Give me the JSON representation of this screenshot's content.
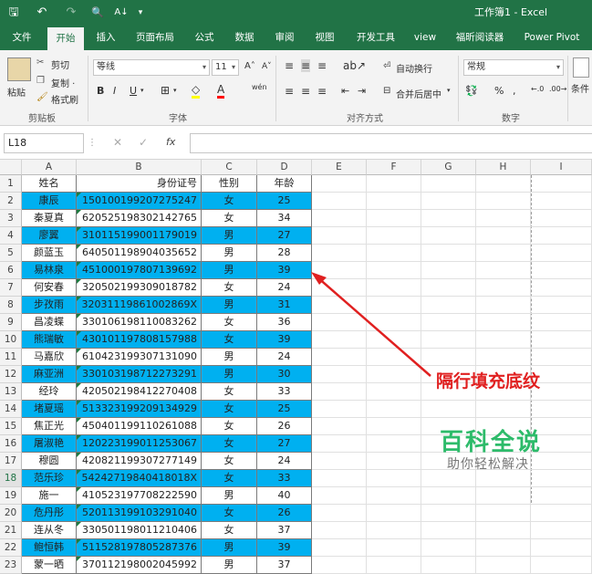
{
  "window": {
    "title": "工作簿1 - Excel",
    "quick_access": {
      "save": "🖫",
      "undo": "↶",
      "redo": "↷",
      "preview": "🔍",
      "sort": "A↓",
      "more": "▾"
    }
  },
  "tabs": [
    "文件",
    "开始",
    "插入",
    "页面布局",
    "公式",
    "数据",
    "审阅",
    "视图",
    "开发工具",
    "view",
    "福昕阅读器",
    "Power Pivot"
  ],
  "active_tab": "开始",
  "ribbon": {
    "clipboard": {
      "paste": "粘贴",
      "cut": "剪切",
      "copy": "复制 ·",
      "format_painter": "格式刷",
      "label": "剪贴板"
    },
    "font": {
      "name": "等线",
      "size": "11",
      "grow": "A˄",
      "shrink": "A˅",
      "bold": "B",
      "italic": "I",
      "underline": "U",
      "wen": "wén",
      "label": "字体"
    },
    "alignment": {
      "wrap": "自动换行",
      "merge": "合并后居中",
      "label": "对齐方式"
    },
    "number": {
      "format": "常规",
      "percent": "%",
      "comma": ",",
      "label": "数字"
    },
    "styles": {
      "cond": "条件"
    }
  },
  "formula_bar": {
    "name_box": "L18",
    "fx": "fx",
    "value": ""
  },
  "colors": {
    "band_fill": "#00B0F0",
    "accent": "#217346",
    "annotation": "#E02020",
    "watermark": "#2DBB6A"
  },
  "columns": [
    "A",
    "B",
    "C",
    "D",
    "E",
    "F",
    "G",
    "H",
    "I"
  ],
  "headers": [
    "姓名",
    "身份证号",
    "性别",
    "年龄"
  ],
  "rows": [
    {
      "n": "1"
    },
    {
      "n": "2",
      "name": "康辰",
      "id": "150100199207275247",
      "sex": "女",
      "age": "25"
    },
    {
      "n": "3",
      "name": "秦夏真",
      "id": "620525198302142765",
      "sex": "女",
      "age": "34"
    },
    {
      "n": "4",
      "name": "廖翼",
      "id": "310115199001179019",
      "sex": "男",
      "age": "27"
    },
    {
      "n": "5",
      "name": "颜蓝玉",
      "id": "640501198904035652",
      "sex": "男",
      "age": "28"
    },
    {
      "n": "6",
      "name": "易林泉",
      "id": "451000197807139692",
      "sex": "男",
      "age": "39"
    },
    {
      "n": "7",
      "name": "何安春",
      "id": "320502199309018782",
      "sex": "女",
      "age": "24"
    },
    {
      "n": "8",
      "name": "步孜雨",
      "id": "32031119861002869X",
      "sex": "男",
      "age": "31"
    },
    {
      "n": "9",
      "name": "昌凌蝶",
      "id": "330106198110083262",
      "sex": "女",
      "age": "36"
    },
    {
      "n": "10",
      "name": "熊瑞敏",
      "id": "430101197808157988",
      "sex": "女",
      "age": "39"
    },
    {
      "n": "11",
      "name": "马嘉欣",
      "id": "610423199307131090",
      "sex": "男",
      "age": "24"
    },
    {
      "n": "12",
      "name": "麻亚洲",
      "id": "330103198712273291",
      "sex": "男",
      "age": "30"
    },
    {
      "n": "13",
      "name": "经玲",
      "id": "420502198412270408",
      "sex": "女",
      "age": "33"
    },
    {
      "n": "14",
      "name": "堵夏瑶",
      "id": "513323199209134929",
      "sex": "女",
      "age": "25"
    },
    {
      "n": "15",
      "name": "焦正光",
      "id": "450401199110261088",
      "sex": "女",
      "age": "26"
    },
    {
      "n": "16",
      "name": "屠淑艳",
      "id": "120223199011253067",
      "sex": "女",
      "age": "27"
    },
    {
      "n": "17",
      "name": "穆圆",
      "id": "420821199307277149",
      "sex": "女",
      "age": "24"
    },
    {
      "n": "18",
      "name": "范乐珍",
      "id": "54242719840418018X",
      "sex": "女",
      "age": "33"
    },
    {
      "n": "19",
      "name": "施一",
      "id": "410523197708222590",
      "sex": "男",
      "age": "40"
    },
    {
      "n": "20",
      "name": "危丹彤",
      "id": "520113199103291040",
      "sex": "女",
      "age": "26"
    },
    {
      "n": "21",
      "name": "连从冬",
      "id": "330501198011210406",
      "sex": "女",
      "age": "37"
    },
    {
      "n": "22",
      "name": "鲍恒韩",
      "id": "511528197805287376",
      "sex": "男",
      "age": "39"
    },
    {
      "n": "23",
      "name": "蒙一晒",
      "id": "370112198002045992",
      "sex": "男",
      "age": "37"
    }
  ],
  "annotation": "隔行填充底纹",
  "watermark": {
    "title": "百科全说",
    "subtitle": "助你轻松解决"
  }
}
